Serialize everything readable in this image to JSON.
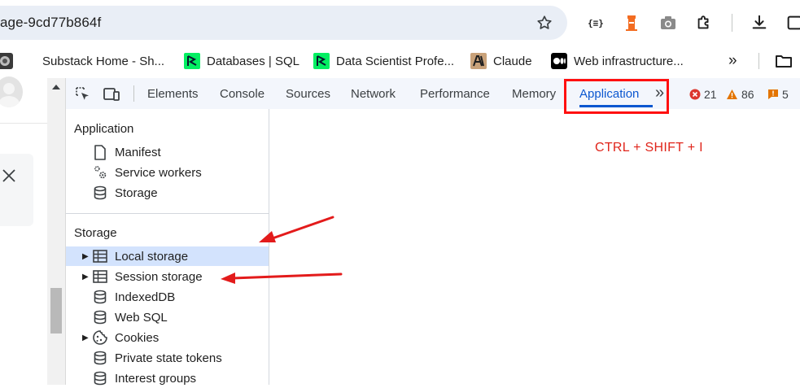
{
  "browser": {
    "url_fragment": "age-9cd77b864f",
    "bookmarks": [
      {
        "label": "Substack Home - Sh...",
        "icon": "substack-icon"
      },
      {
        "label": "Databases | SQL",
        "icon": "datacamp-icon"
      },
      {
        "label": "Data Scientist Profe...",
        "icon": "datacamp-icon"
      },
      {
        "label": "Claude",
        "icon": "anthropic-icon"
      },
      {
        "label": "Web infrastructure...",
        "icon": "medium-icon"
      }
    ]
  },
  "devtools": {
    "tabs": [
      "Elements",
      "Console",
      "Sources",
      "Network",
      "Performance",
      "Memory",
      "Application"
    ],
    "active_tab": "Application",
    "errors": "21",
    "warnings": "86",
    "issues": "5",
    "sidebar": {
      "application_section": "Application",
      "application_items": [
        "Manifest",
        "Service workers",
        "Storage"
      ],
      "storage_section": "Storage",
      "storage_items": [
        "Local storage",
        "Session storage",
        "IndexedDB",
        "Web SQL",
        "Cookies",
        "Private state tokens",
        "Interest groups"
      ]
    }
  },
  "annotation": {
    "shortcut": "CTRL + SHIFT + I",
    "color": "#e0251b"
  }
}
